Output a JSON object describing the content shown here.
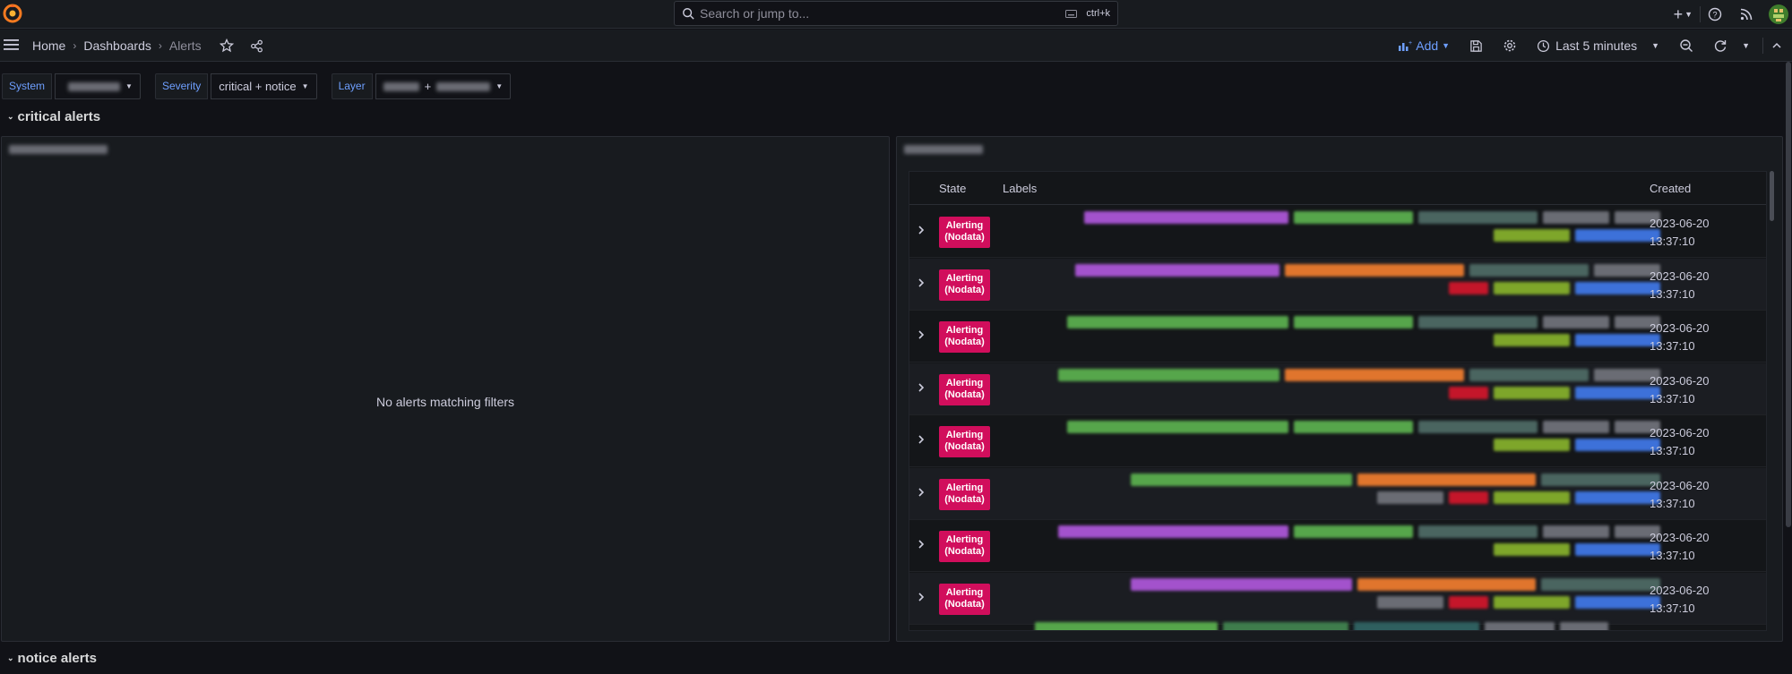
{
  "topbar": {
    "search_placeholder": "Search or jump to...",
    "search_shortcut": "ctrl+k",
    "icons": [
      "grafana-logo-icon",
      "plus-icon",
      "help-icon",
      "rss-icon",
      "avatar"
    ]
  },
  "breadcrumbs": [
    "Home",
    "Dashboards",
    "Alerts"
  ],
  "toolbar": {
    "add_label": "Add",
    "time_range": "Last 5 minutes"
  },
  "variables": [
    {
      "label": "System",
      "value": ""
    },
    {
      "label": "Severity",
      "value": "critical + notice"
    },
    {
      "label": "Layer",
      "value": "+"
    }
  ],
  "rows": {
    "critical": "critical alerts",
    "notice": "notice alerts"
  },
  "left_panel": {
    "title": "",
    "empty_message": "No alerts matching filters"
  },
  "right_panel": {
    "title": "",
    "columns": [
      "State",
      "Labels",
      "Created"
    ],
    "alerts": [
      {
        "state_line1": "Alerting",
        "state_line2": "(Nodata)",
        "created_date": "2023-06-20",
        "created_time": "13:37:10"
      },
      {
        "state_line1": "Alerting",
        "state_line2": "(Nodata)",
        "created_date": "2023-06-20",
        "created_time": "13:37:10"
      },
      {
        "state_line1": "Alerting",
        "state_line2": "(Nodata)",
        "created_date": "2023-06-20",
        "created_time": "13:37:10"
      },
      {
        "state_line1": "Alerting",
        "state_line2": "(Nodata)",
        "created_date": "2023-06-20",
        "created_time": "13:37:10"
      },
      {
        "state_line1": "Alerting",
        "state_line2": "(Nodata)",
        "created_date": "2023-06-20",
        "created_time": "13:37:10"
      },
      {
        "state_line1": "Alerting",
        "state_line2": "(Nodata)",
        "created_date": "2023-06-20",
        "created_time": "13:37:10"
      },
      {
        "state_line1": "Alerting",
        "state_line2": "(Nodata)",
        "created_date": "2023-06-20",
        "created_time": "13:37:10"
      },
      {
        "state_line1": "Alerting",
        "state_line2": "(Nodata)",
        "created_date": "2023-06-20",
        "created_time": "13:37:10"
      }
    ]
  },
  "colors": {
    "alerting": "#d10e5c",
    "accent": "#6e9fff",
    "background": "#111217",
    "panel": "#181b1f"
  }
}
